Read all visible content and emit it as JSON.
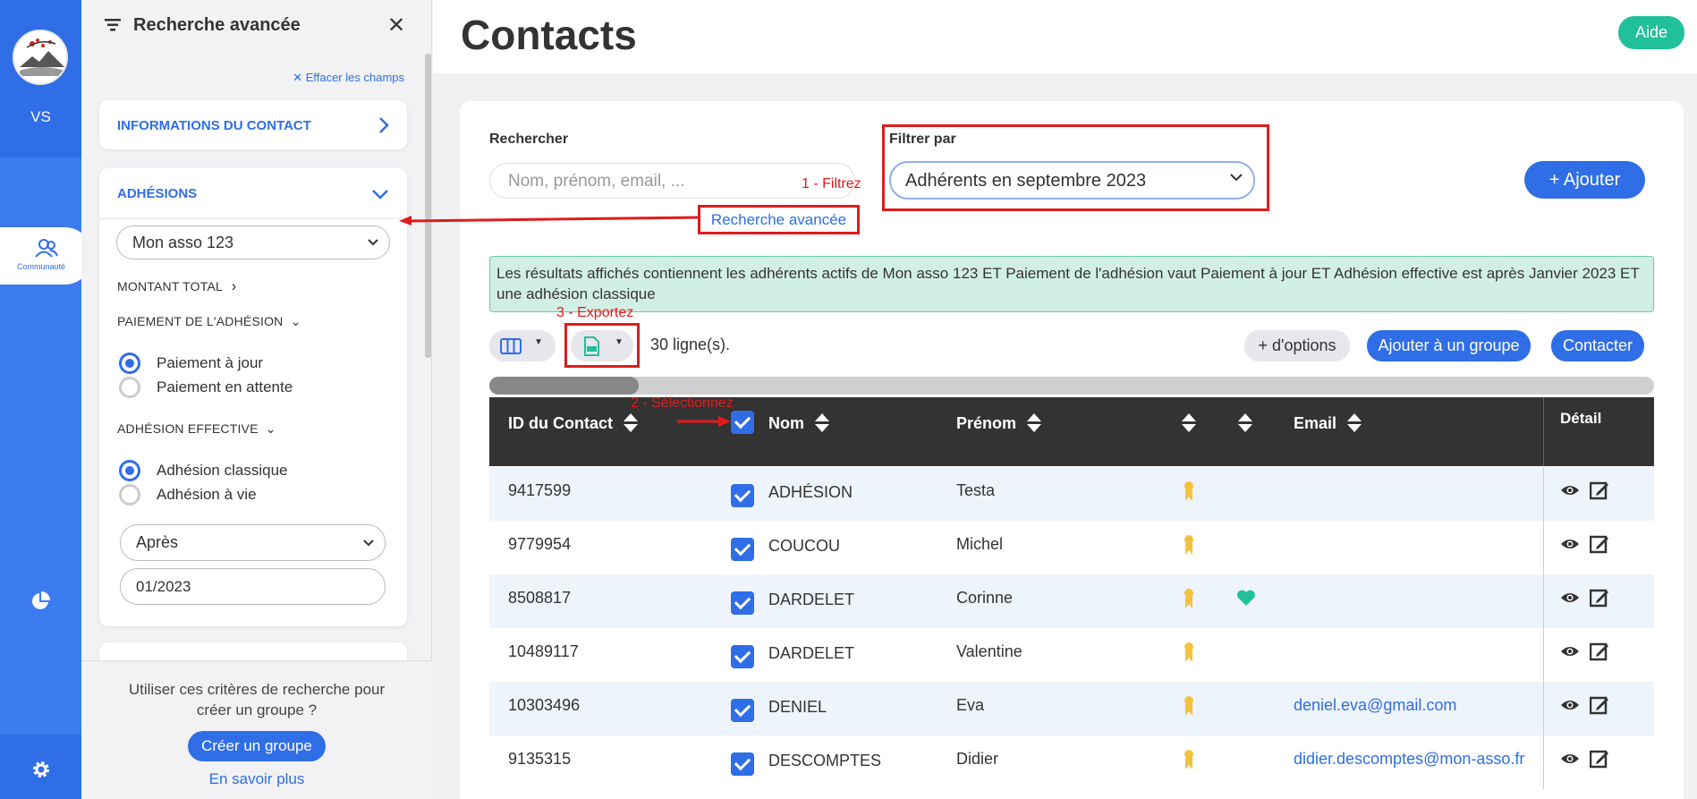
{
  "rail": {
    "org_initials": "VS",
    "community_label": "Communauté"
  },
  "panel": {
    "title": "Recherche avancée",
    "clear_label": "Effacer les champs",
    "contact_info_title": "INFORMATIONS DU CONTACT",
    "adhesions_title": "ADHÉSIONS",
    "asso_select": "Mon asso 123",
    "montant_total": "MONTANT TOTAL",
    "paiement_title": "PAIEMENT DE L'ADHÉSION",
    "paiement_options": [
      "Paiement à jour",
      "Paiement en attente"
    ],
    "effective_title": "ADHÉSION EFFECTIVE",
    "effective_options": [
      "Adhésion classique",
      "Adhésion à vie"
    ],
    "date_operator": "Après",
    "date_value": "01/2023",
    "footer_question": "Utiliser ces critères de recherche pour créer un groupe ?",
    "create_group": "Créer un groupe",
    "learn_more": "En savoir plus"
  },
  "header": {
    "title": "Contacts",
    "help": "Aide"
  },
  "search": {
    "label": "Rechercher",
    "placeholder": "Nom, prénom, email, ...",
    "filter_label": "Filtrer par",
    "filter_value": "Adhérents en septembre 2023",
    "add_button": "+ Ajouter",
    "advanced_link": "Recherche avancée"
  },
  "annotations": {
    "step1": "1 - Filtrez",
    "step2": "2 - Sélectionnez",
    "step3": "3 - Exportez"
  },
  "info_text": "Les résultats affichés contiennent les adhérents actifs de Mon asso 123 ET Paiement de l'adhésion vaut Paiement à jour ET Adhésion effective est après Janvier 2023 ET une adhésion classique",
  "toolbar": {
    "rows_count": "30 ligne(s).",
    "more_options": "+ d'options",
    "add_to_group": "Ajouter à un groupe",
    "contact": "Contacter"
  },
  "table": {
    "headers": {
      "id": "ID du Contact",
      "nom": "Nom",
      "prenom": "Prénom",
      "email": "Email",
      "detail": "Détail"
    },
    "rows": [
      {
        "id": "9417599",
        "nom": "ADHÉSION",
        "prenom": "Testa",
        "email": "",
        "heart": false
      },
      {
        "id": "9779954",
        "nom": "COUCOU",
        "prenom": "Michel",
        "email": "",
        "heart": false
      },
      {
        "id": "8508817",
        "nom": "DARDELET",
        "prenom": "Corinne",
        "email": "",
        "heart": true
      },
      {
        "id": "10489117",
        "nom": "DARDELET",
        "prenom": "Valentine",
        "email": "",
        "heart": false
      },
      {
        "id": "10303496",
        "nom": "DENIEL",
        "prenom": "Eva",
        "email": "deniel.eva@gmail.com",
        "heart": false
      },
      {
        "id": "9135315",
        "nom": "DESCOMPTES",
        "prenom": "Didier",
        "email": "didier.descomptes@mon-asso.fr",
        "heart": false
      }
    ]
  }
}
